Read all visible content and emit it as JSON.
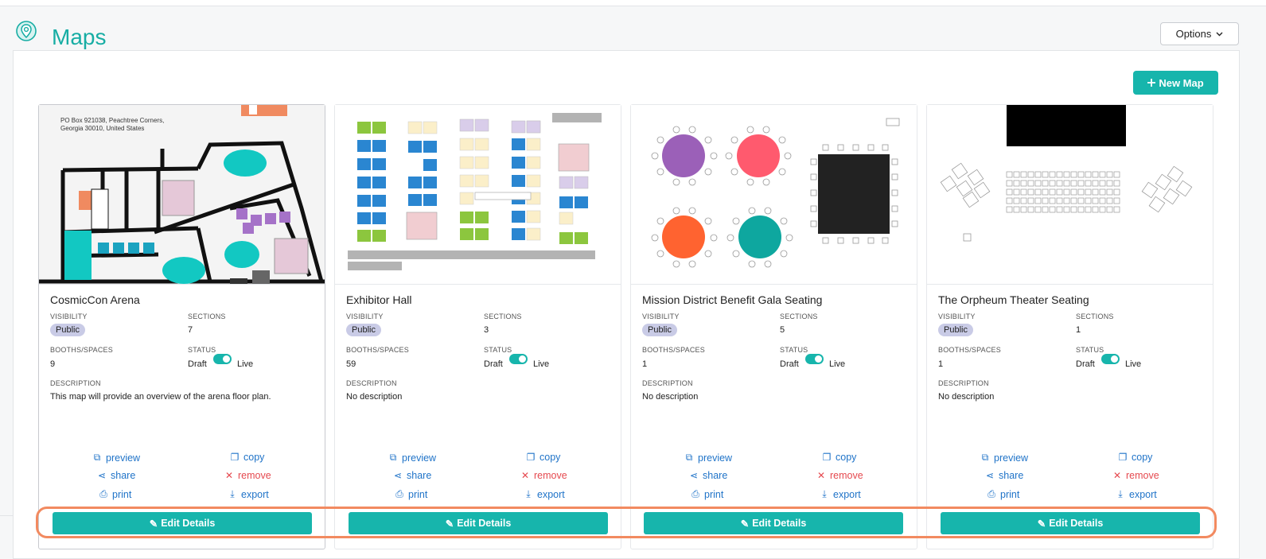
{
  "page": {
    "title": "Maps",
    "options_label": "Options",
    "new_map_label": "New Map"
  },
  "colors": {
    "accent": "#17b5ac",
    "title": "#17ada4",
    "link": "#1f73c8",
    "danger": "#e5494f",
    "badge": "#c9cbe6",
    "highlight": "#f28a60"
  },
  "labels": {
    "visibility": "VISIBILITY",
    "sections": "SECTIONS",
    "booths": "BOOTHS/SPACES",
    "status": "STATUS",
    "description": "DESCRIPTION",
    "draft": "Draft",
    "live": "Live",
    "preview": "preview",
    "copy": "copy",
    "share": "share",
    "remove": "remove",
    "print": "print",
    "export": "export",
    "edit": "Edit Details"
  },
  "icons": {
    "pin": "map-pin-icon",
    "plus": "plus-icon",
    "chevron": "chevron-down-icon",
    "preview": "external-link-icon",
    "copy": "copy-icon",
    "share": "share-icon",
    "remove": "close-icon",
    "print": "printer-icon",
    "export": "download-icon",
    "edit": "pencil-icon"
  },
  "thumbnail_text": {
    "arena_address_line1": "PO Box 921038, Peachtree Corners,",
    "arena_address_line2": "Georgia 30010, United States"
  },
  "maps": [
    {
      "name": "CosmicCon Arena",
      "visibility": "Public",
      "sections": "7",
      "booths": "9",
      "status_live": true,
      "description": "This map will provide an overview of the arena floor plan."
    },
    {
      "name": "Exhibitor Hall",
      "visibility": "Public",
      "sections": "3",
      "booths": "59",
      "status_live": true,
      "description": "No description"
    },
    {
      "name": "Mission District Benefit Gala Seating",
      "visibility": "Public",
      "sections": "5",
      "booths": "1",
      "status_live": true,
      "description": "No description"
    },
    {
      "name": "The Orpheum Theater Seating",
      "visibility": "Public",
      "sections": "1",
      "booths": "1",
      "status_live": true,
      "description": "No description"
    }
  ]
}
